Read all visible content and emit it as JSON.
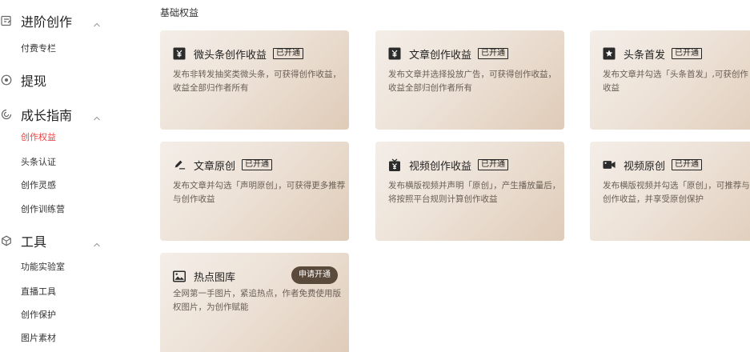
{
  "sidebar": {
    "groups": [
      {
        "label": "进阶创作",
        "icon": "edit-icon",
        "items": [
          "付费专栏"
        ]
      },
      {
        "label": "提现",
        "icon": "coin-icon",
        "items": []
      },
      {
        "label": "成长指南",
        "icon": "growth-icon",
        "items": [
          "创作权益",
          "头条认证",
          "创作灵感",
          "创作训练营"
        ]
      },
      {
        "label": "工具",
        "icon": "cube-icon",
        "items": [
          "功能实验室",
          "直播工具",
          "创作保护",
          "图片素材"
        ]
      }
    ],
    "active_item": "创作权益",
    "active_color": "#f04142"
  },
  "main": {
    "section_title": "基础权益",
    "cards": [
      {
        "title": "微头条创作收益",
        "badge": "已开通",
        "desc": "发布非转发抽奖类微头条，可获得创作收益，收益全部归作者所有",
        "icon": "yuan-icon"
      },
      {
        "title": "文章创作收益",
        "badge": "已开通",
        "desc": "发布文章并选择投放广告，可获得创作收益，收益全部归创作者所有",
        "icon": "yuan-icon"
      },
      {
        "title": "头条首发",
        "badge": "已开通",
        "desc": "发布文章并勾选「头条首发」,可获创作收益",
        "icon": "star-icon"
      },
      {
        "title": "文章原创",
        "badge": "已开通",
        "desc": "发布文章并勾选「声明原创」，可获得更多推荐与创作收益",
        "icon": "pen-icon"
      },
      {
        "title": "视频创作收益",
        "badge": "已开通",
        "desc": "发布横版视频并声明「原创」，产生播放量后，将按照平台规则计算创作收益",
        "icon": "tv-yuan-icon"
      },
      {
        "title": "视频原创",
        "badge": "已开通",
        "desc": "发布横版视频并勾选「原创」，可推荐与创作收益，并享受原创保护",
        "icon": "video-camera-icon"
      },
      {
        "title": "热点图库",
        "apply_label": "申请开通",
        "desc": "全网第一手图片，紧追热点，作者免费使用版权图片，为创作赋能",
        "icon": "image-icon"
      }
    ]
  },
  "colors": {
    "accent": "#f04142",
    "card_gradient_start": "#f4eee8",
    "card_gradient_end": "#dfcbb8",
    "apply_button": "#5a4a3c",
    "description_text": "#6a5f55"
  }
}
